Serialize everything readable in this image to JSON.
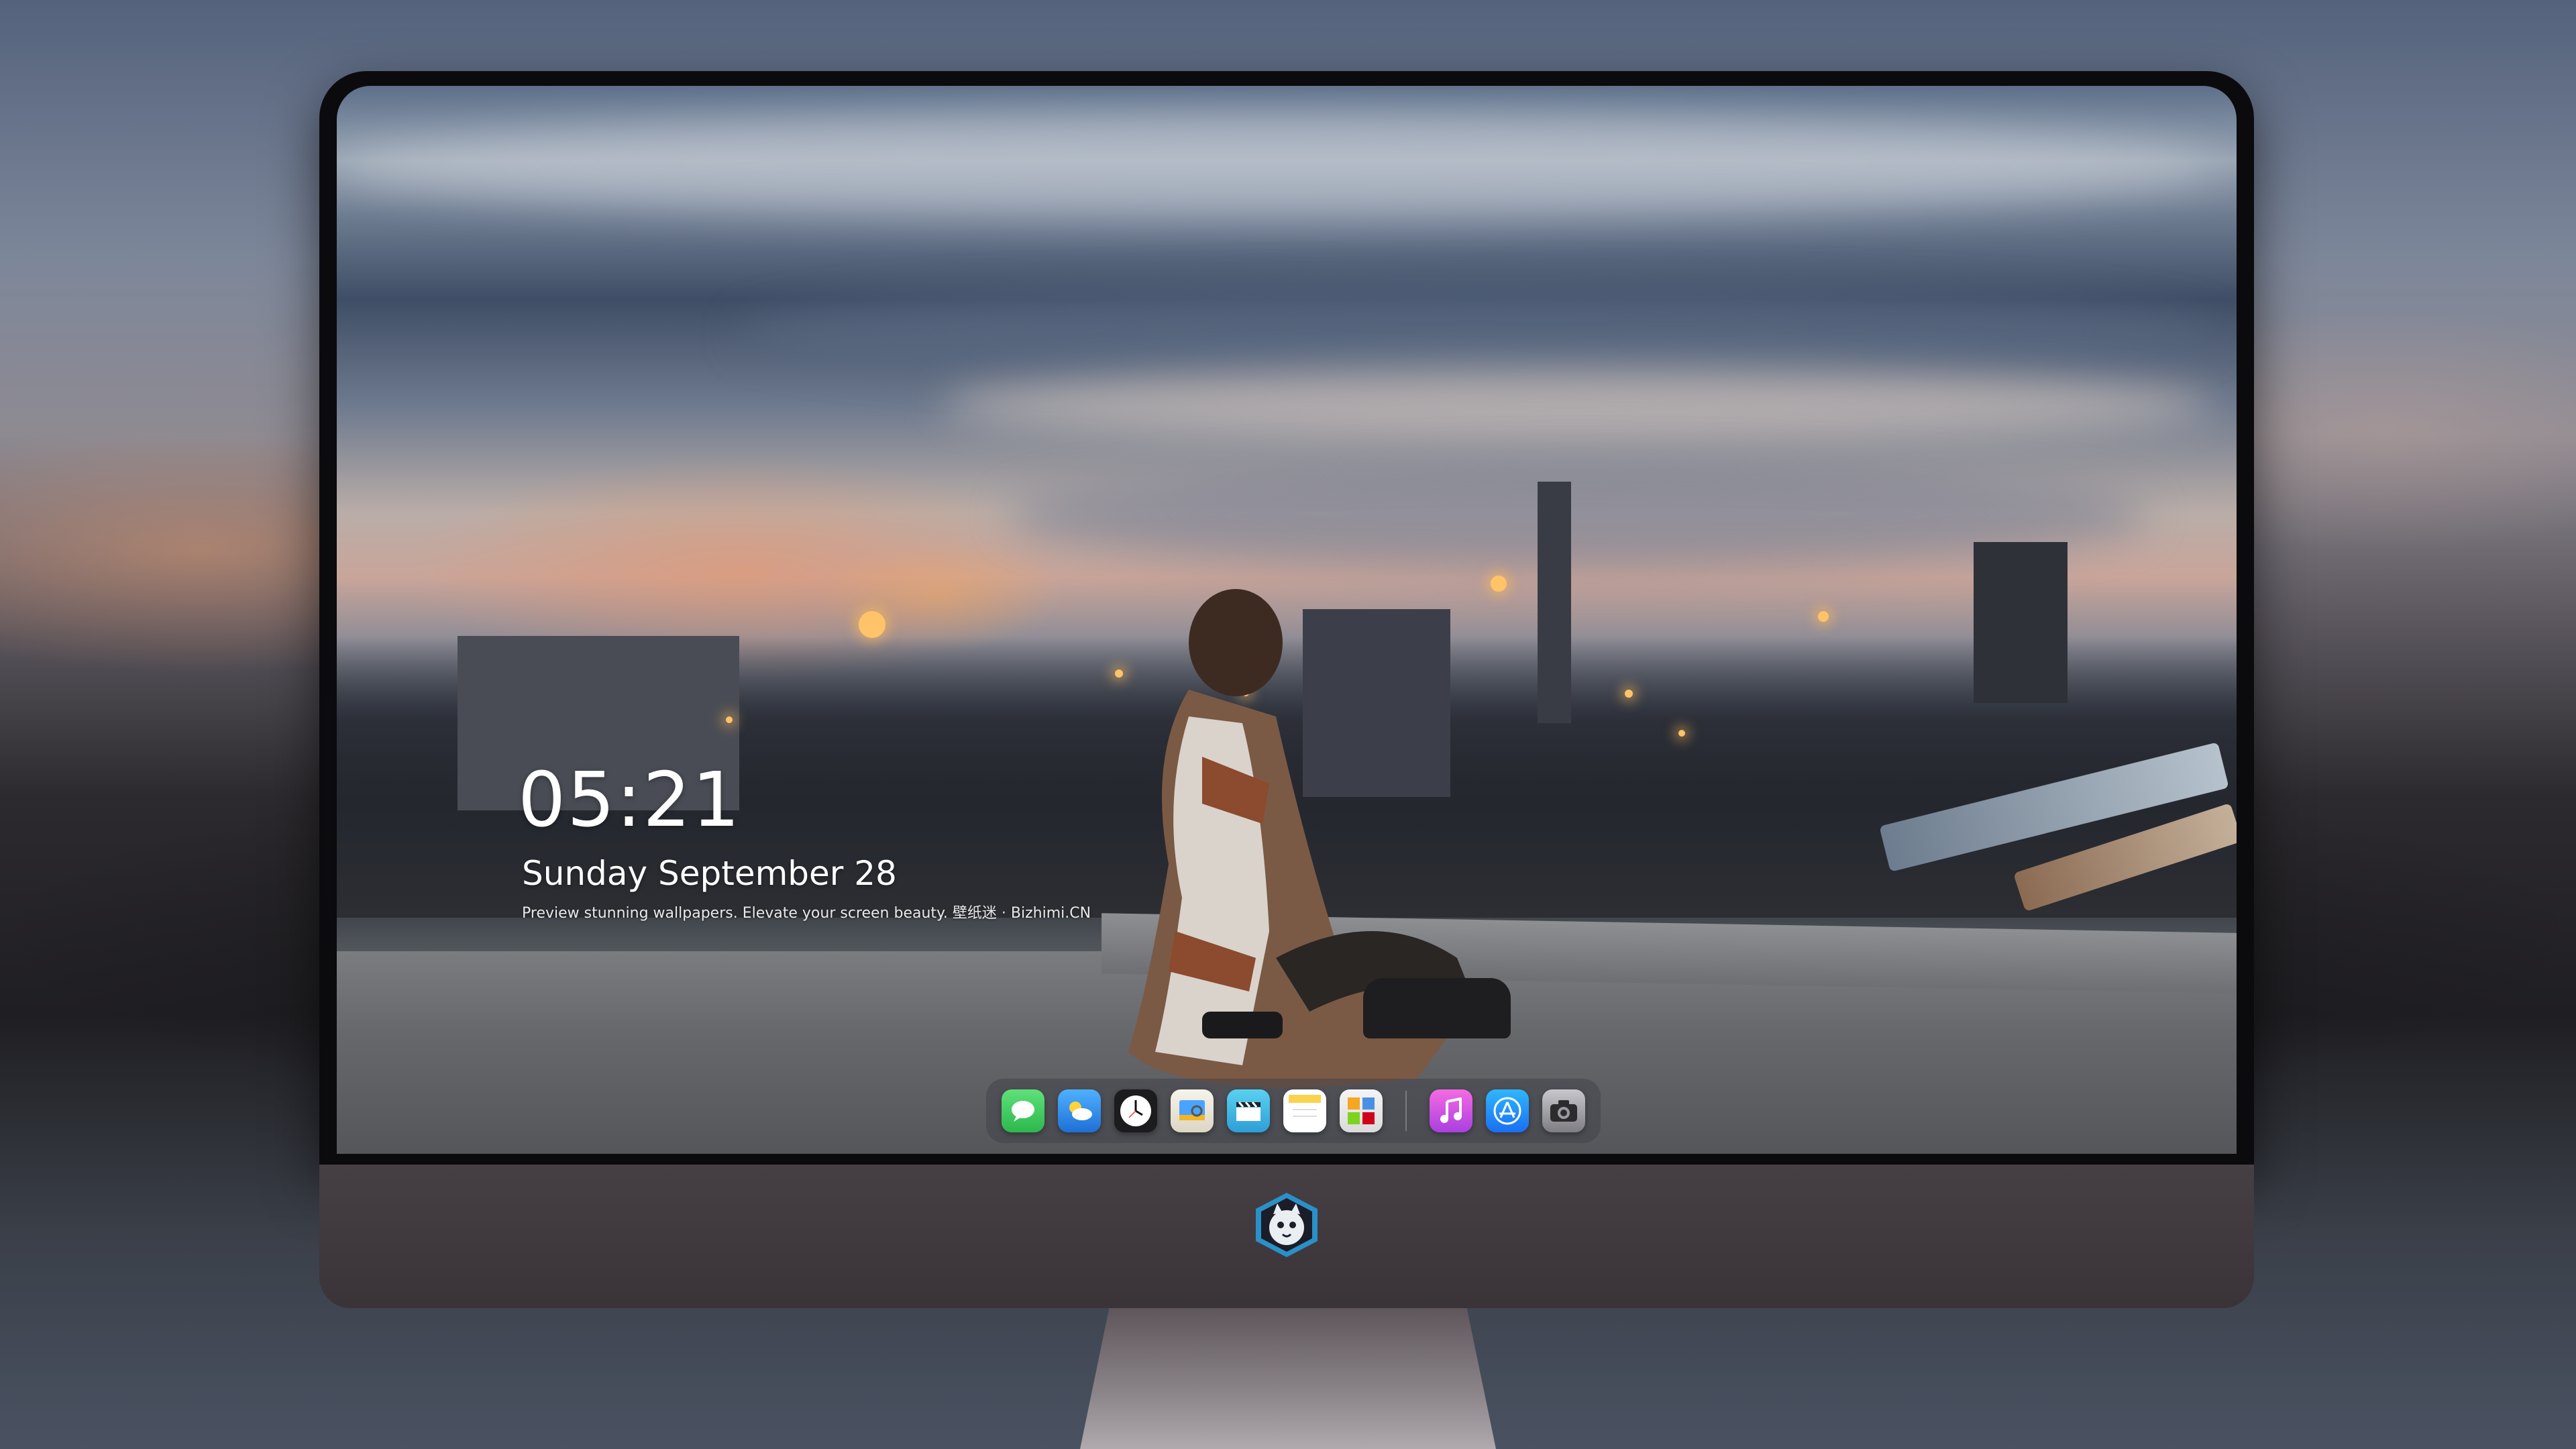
{
  "lock_screen": {
    "time": "05:21",
    "date": "Sunday September  28",
    "tagline": "Preview stunning wallpapers. Elevate your screen beauty. 壁纸迷 · Bizhimi.CN"
  },
  "dock": {
    "apps": [
      {
        "name": "Messages",
        "icon": "messages-icon",
        "color": "#34c759"
      },
      {
        "name": "Weather",
        "icon": "weather-icon",
        "color": "#2f8df0"
      },
      {
        "name": "Clock",
        "icon": "clock-icon",
        "color": "#ffffff"
      },
      {
        "name": "Preview",
        "icon": "preview-icon",
        "color": "#f2c14e"
      },
      {
        "name": "Clips",
        "icon": "clapperboard-icon",
        "color": "#48c3e8"
      },
      {
        "name": "Notes",
        "icon": "notes-icon",
        "color": "#fde36b"
      },
      {
        "name": "Photo Booth",
        "icon": "grid-app-icon",
        "color": "#e9583f"
      },
      {
        "name": "Music",
        "icon": "music-icon",
        "color": "#d04ed6"
      },
      {
        "name": "App Store",
        "icon": "app-store-icon",
        "color": "#1c8ef9"
      },
      {
        "name": "Camera",
        "icon": "camera-icon",
        "color": "#8e8e93"
      }
    ]
  },
  "branding": {
    "chin_logo": "mascot-logo-icon"
  }
}
